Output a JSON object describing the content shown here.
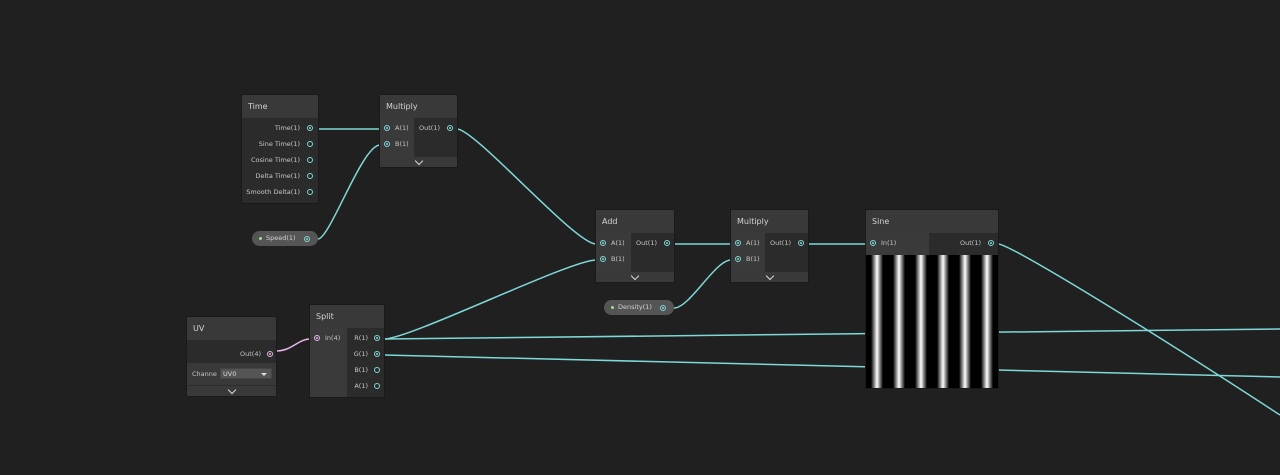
{
  "colors": {
    "background": "#202020",
    "wire_float": "#7ed8d6",
    "wire_vector": "#e8b4e8",
    "property_dot": "#9be08a"
  },
  "nodes": {
    "time": {
      "title": "Time",
      "outputs": [
        "Time(1)",
        "Sine Time(1)",
        "Cosine Time(1)",
        "Delta Time(1)",
        "Smooth Delta(1)"
      ]
    },
    "multiply1": {
      "title": "Multiply",
      "inputs": [
        "A(1)",
        "B(1)"
      ],
      "output": "Out(1)"
    },
    "speed": {
      "label": "Speed(1)"
    },
    "add": {
      "title": "Add",
      "inputs": [
        "A(1)",
        "B(1)"
      ],
      "output": "Out(1)"
    },
    "multiply2": {
      "title": "Multiply",
      "inputs": [
        "A(1)",
        "B(1)"
      ],
      "output": "Out(1)"
    },
    "density": {
      "label": "Density(1)"
    },
    "sine": {
      "title": "Sine",
      "input": "In(1)",
      "output": "Out(1)",
      "preview_icon": "sine-stripes-preview"
    },
    "uv": {
      "title": "UV",
      "output": "Out(4)",
      "channel_label": "Channe",
      "channel_value": "UV0"
    },
    "split": {
      "title": "Split",
      "input": "In(4)",
      "outputs": [
        "R(1)",
        "G(1)",
        "B(1)",
        "A(1)"
      ]
    }
  },
  "icons": {
    "expander": "chevron-down-icon",
    "dropdown": "caret-down-icon"
  }
}
